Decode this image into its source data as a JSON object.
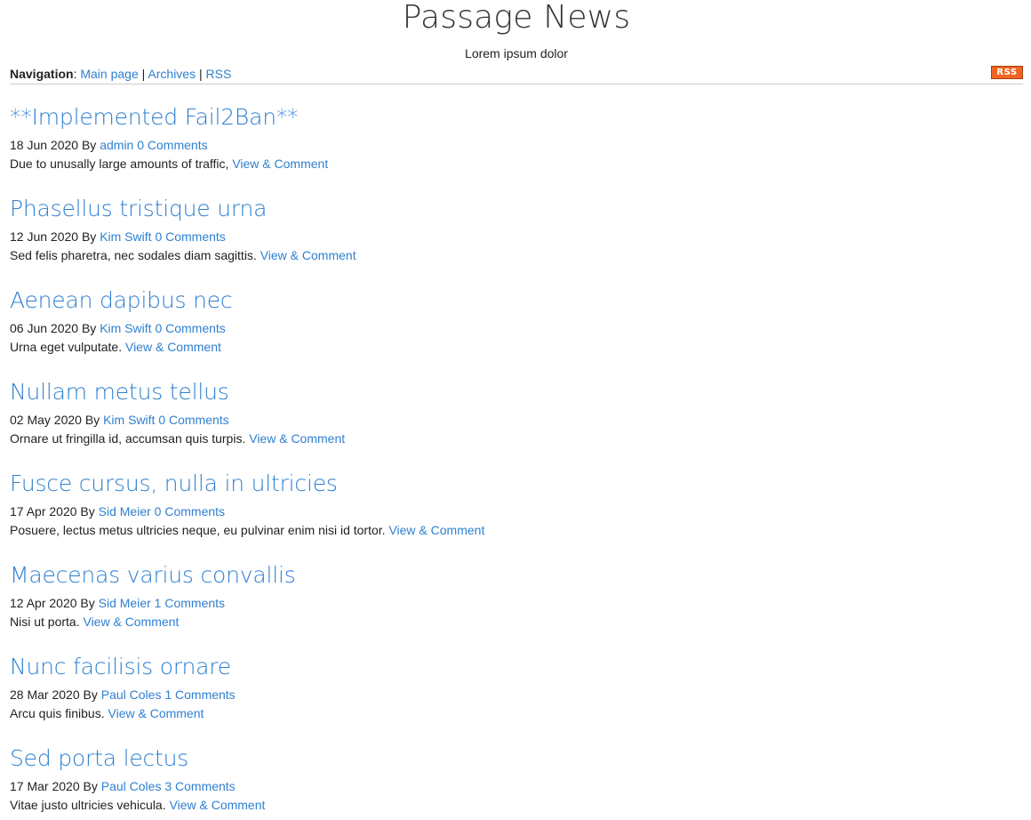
{
  "site": {
    "title": "Passage News",
    "subtitle": "Lorem ipsum dolor"
  },
  "nav": {
    "label": "Navigation",
    "colon": ":",
    "separator": "|",
    "links": [
      "Main page",
      "Archives",
      "RSS"
    ],
    "rss_badge": "RSS",
    "rss_badge_color": "#f26522"
  },
  "link_color": "#2f80d0",
  "posts": [
    {
      "title": "**Implemented Fail2Ban**",
      "date": "18 Jun 2020",
      "by": "By",
      "author": "admin",
      "comments": "0 Comments",
      "excerpt": "Due to unusally large amounts of traffic,",
      "view_link": "View & Comment"
    },
    {
      "title": "Phasellus tristique urna",
      "date": "12 Jun 2020",
      "by": "By",
      "author": "Kim Swift",
      "comments": "0 Comments",
      "excerpt": "Sed felis pharetra, nec sodales diam sagittis.",
      "view_link": "View & Comment"
    },
    {
      "title": "Aenean dapibus nec",
      "date": "06 Jun 2020",
      "by": "By",
      "author": "Kim Swift",
      "comments": "0 Comments",
      "excerpt": "Urna eget vulputate.",
      "view_link": "View & Comment"
    },
    {
      "title": "Nullam metus tellus",
      "date": "02 May 2020",
      "by": "By",
      "author": "Kim Swift",
      "comments": "0 Comments",
      "excerpt": "Ornare ut fringilla id, accumsan quis turpis.",
      "view_link": "View & Comment"
    },
    {
      "title": "Fusce cursus, nulla in ultricies",
      "date": "17 Apr 2020",
      "by": "By",
      "author": "Sid Meier",
      "comments": "0 Comments",
      "excerpt": "Posuere, lectus metus ultricies neque, eu pulvinar enim nisi id tortor.",
      "view_link": "View & Comment"
    },
    {
      "title": "Maecenas varius convallis",
      "date": "12 Apr 2020",
      "by": "By",
      "author": "Sid Meier",
      "comments": "1 Comments",
      "excerpt": "Nisi ut porta.",
      "view_link": "View & Comment"
    },
    {
      "title": "Nunc facilisis ornare",
      "date": "28 Mar 2020",
      "by": "By",
      "author": "Paul Coles",
      "comments": "1 Comments",
      "excerpt": "Arcu quis finibus.",
      "view_link": "View & Comment"
    },
    {
      "title": "Sed porta lectus",
      "date": "17 Mar 2020",
      "by": "By",
      "author": "Paul Coles",
      "comments": "3 Comments",
      "excerpt": "Vitae justo ultricies vehicula.",
      "view_link": "View & Comment"
    }
  ]
}
